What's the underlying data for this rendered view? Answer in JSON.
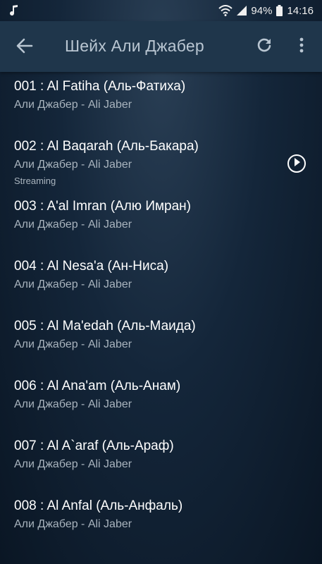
{
  "status_bar": {
    "music_icon": "music-note-icon",
    "battery": "94%",
    "time": "14:16"
  },
  "app_bar": {
    "title": "Шейх Али Джабер",
    "back_icon": "arrow-left-icon",
    "refresh_icon": "refresh-icon",
    "more_icon": "more-vert-icon"
  },
  "tracks": [
    {
      "title": "001 : Al Fatiha (Аль-Фатиха)",
      "artist": "Али Джабер - Ali Jaber"
    },
    {
      "title": "002 : Al Baqarah (Аль-Бакара)",
      "artist": "Али Джабер - Ali Jaber",
      "status": "Streaming",
      "playing": true
    },
    {
      "title": "003 : A'al Imran (Алю Имран)",
      "artist": "Али Джабер - Ali Jaber"
    },
    {
      "title": "004 : Al Nesa'a (Ан-Ниса)",
      "artist": "Али Джабер - Ali Jaber"
    },
    {
      "title": "005 : Al Ma'edah (Аль-Маида)",
      "artist": "Али Джабер - Ali Jaber"
    },
    {
      "title": "006 :  Al Ana'am (Аль-Анам)",
      "artist": "Али Джабер - Ali Jaber"
    },
    {
      "title": "007 : Al A`araf (Аль-Араф)",
      "artist": "Али Джабер - Ali Jaber"
    },
    {
      "title": "008 : Al Anfal (Аль-Анфаль)",
      "artist": "Али Джабер - Ali Jaber"
    }
  ],
  "colors": {
    "app_bar": "#1f364b",
    "title_text": "#b9c6d2",
    "secondary_text": "#a9b4be",
    "background_dark": "#0a1624"
  }
}
